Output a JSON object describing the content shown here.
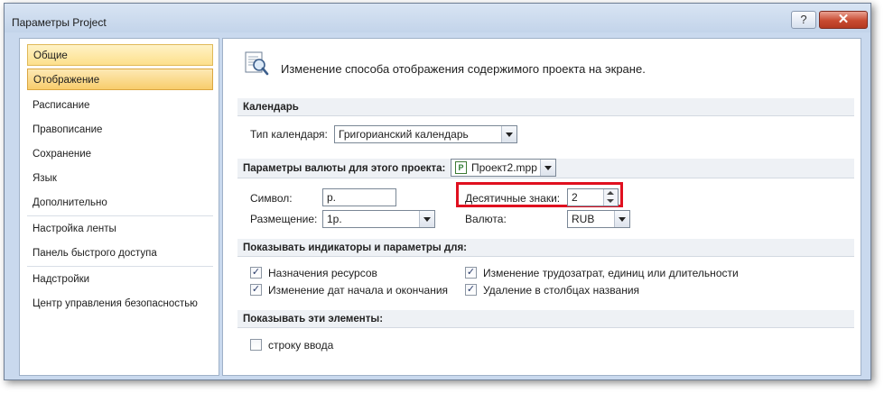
{
  "window": {
    "title": "Параметры Project",
    "help_glyph": "?",
    "close_glyph": "✕"
  },
  "nav": {
    "items": [
      {
        "label": "Общие"
      },
      {
        "label": "Отображение"
      },
      {
        "label": "Расписание"
      },
      {
        "label": "Правописание"
      },
      {
        "label": "Сохранение"
      },
      {
        "label": "Язык"
      },
      {
        "label": "Дополнительно"
      },
      {
        "label": "Настройка ленты"
      },
      {
        "label": "Панель быстрого доступа"
      },
      {
        "label": "Надстройки"
      },
      {
        "label": "Центр управления безопасностью"
      }
    ],
    "selected_index": 1
  },
  "content": {
    "intro": "Изменение способа отображения содержимого проекта на экране.",
    "calendar_section": {
      "header": "Календарь",
      "type_label": "Тип календаря:",
      "type_value": "Григорианский календарь"
    },
    "currency_section": {
      "header": "Параметры валюты для этого проекта:",
      "project_value": "Проект2.mpp",
      "project_icon_glyph": "P",
      "symbol_label": "Символ:",
      "symbol_value": "р.",
      "placement_label": "Размещение:",
      "placement_value": "1р.",
      "decimals_label": "Десятичные знаки:",
      "decimals_value": "2",
      "currency_label": "Валюта:",
      "currency_value": "RUB"
    },
    "indicators_section": {
      "header": "Показывать индикаторы и параметры для:",
      "options": [
        {
          "label": "Назначения ресурсов",
          "checked": true
        },
        {
          "label": "Изменение дат начала и окончания",
          "checked": true
        },
        {
          "label": "Изменение трудозатрат, единиц или длительности",
          "checked": true
        },
        {
          "label": "Удаление в столбцах названия",
          "checked": true
        }
      ]
    },
    "elements_section": {
      "header": "Показывать эти элементы:",
      "options": [
        {
          "label": "строку ввода",
          "checked": false
        }
      ]
    }
  },
  "colors": {
    "highlight_border": "#e0101f",
    "nav_active": "#f8cd6c"
  },
  "check_glyph": "✓"
}
